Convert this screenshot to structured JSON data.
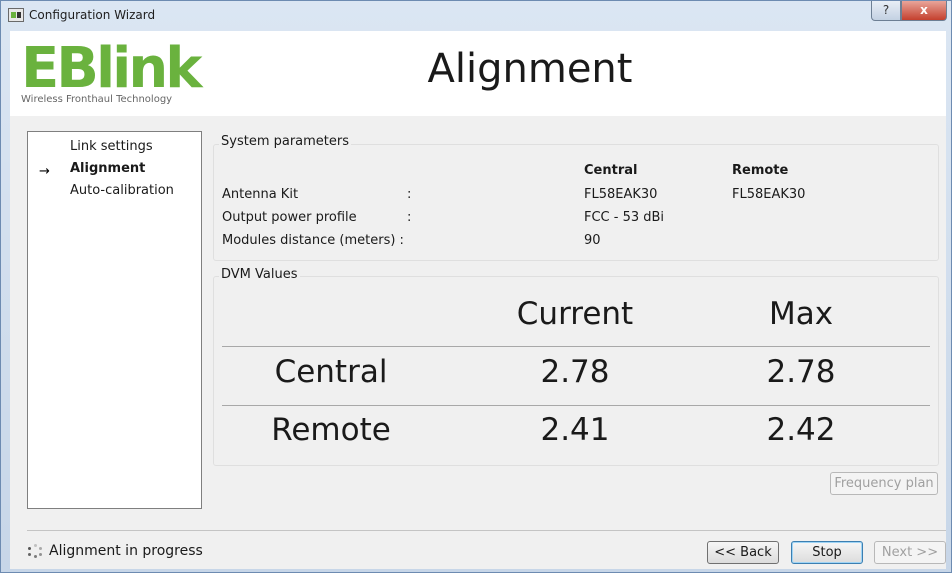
{
  "window": {
    "title": "Configuration Wizard",
    "help_label": "?",
    "close_label": "x"
  },
  "header": {
    "logo_text": "EBlink",
    "logo_tagline": "Wireless Fronthaul Technology",
    "page_title": "Alignment"
  },
  "steps": {
    "arrow": "→",
    "items": [
      {
        "label": "Link settings",
        "active": false
      },
      {
        "label": "Alignment",
        "active": true
      },
      {
        "label": "Auto-calibration",
        "active": false
      }
    ]
  },
  "system_parameters": {
    "title": "System parameters",
    "col_central": "Central",
    "col_remote": "Remote",
    "rows": [
      {
        "label": "Antenna Kit",
        "colon": ":",
        "central": "FL58EAK30",
        "remote": "FL58EAK30"
      },
      {
        "label": "Output power profile",
        "colon": ":",
        "central": "FCC - 53 dBi",
        "remote": ""
      },
      {
        "label": "Modules distance (meters) :",
        "colon": "",
        "central": "90",
        "remote": ""
      }
    ]
  },
  "dvm": {
    "title": "DVM Values",
    "col_current": "Current",
    "col_max": "Max",
    "rows": [
      {
        "label": "Central",
        "current": "2.78",
        "max": "2.78"
      },
      {
        "label": "Remote",
        "current": "2.41",
        "max": "2.42"
      }
    ]
  },
  "frequency_plan_label": "Frequency plan",
  "status": {
    "text": "Alignment in progress"
  },
  "nav": {
    "back_label": "<< Back",
    "stop_label": "Stop",
    "next_label": "Next >>"
  }
}
